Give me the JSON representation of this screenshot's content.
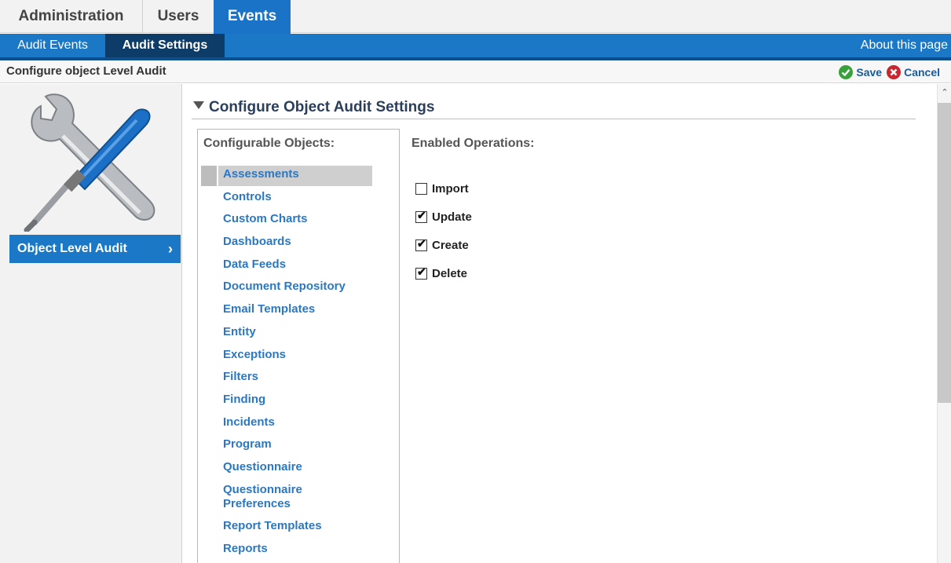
{
  "top_tabs": [
    {
      "label": "Administration"
    },
    {
      "label": "Users"
    },
    {
      "label": "Events"
    }
  ],
  "sub_tabs": [
    {
      "label": "Audit Events"
    },
    {
      "label": "Audit Settings"
    }
  ],
  "about_link": "About this page",
  "page_title": "Configure object Level Audit",
  "actions": {
    "save": "Save",
    "cancel": "Cancel"
  },
  "left_nav": {
    "label": "Object Level Audit",
    "chevron": "›"
  },
  "section_title": "Configure Object Audit Settings",
  "configurable_objects_label": "Configurable Objects:",
  "objects": [
    "Assessments",
    "Controls",
    "Custom Charts",
    "Dashboards",
    "Data Feeds",
    "Document Repository",
    "Email Templates",
    "Entity",
    "Exceptions",
    "Filters",
    "Finding",
    "Incidents",
    "Program",
    "Questionnaire",
    "Questionnaire Preferences",
    "Report Templates",
    "Reports"
  ],
  "selected_object": "Assessments",
  "enabled_operations_label": "Enabled Operations:",
  "operations": [
    {
      "label": "Import",
      "checked": false
    },
    {
      "label": "Update",
      "checked": true
    },
    {
      "label": "Create",
      "checked": true
    },
    {
      "label": "Delete",
      "checked": true
    }
  ],
  "colors": {
    "brand_blue": "#1b78c6",
    "dark_blue": "#0d3c68",
    "link_blue": "#2a78c4"
  }
}
